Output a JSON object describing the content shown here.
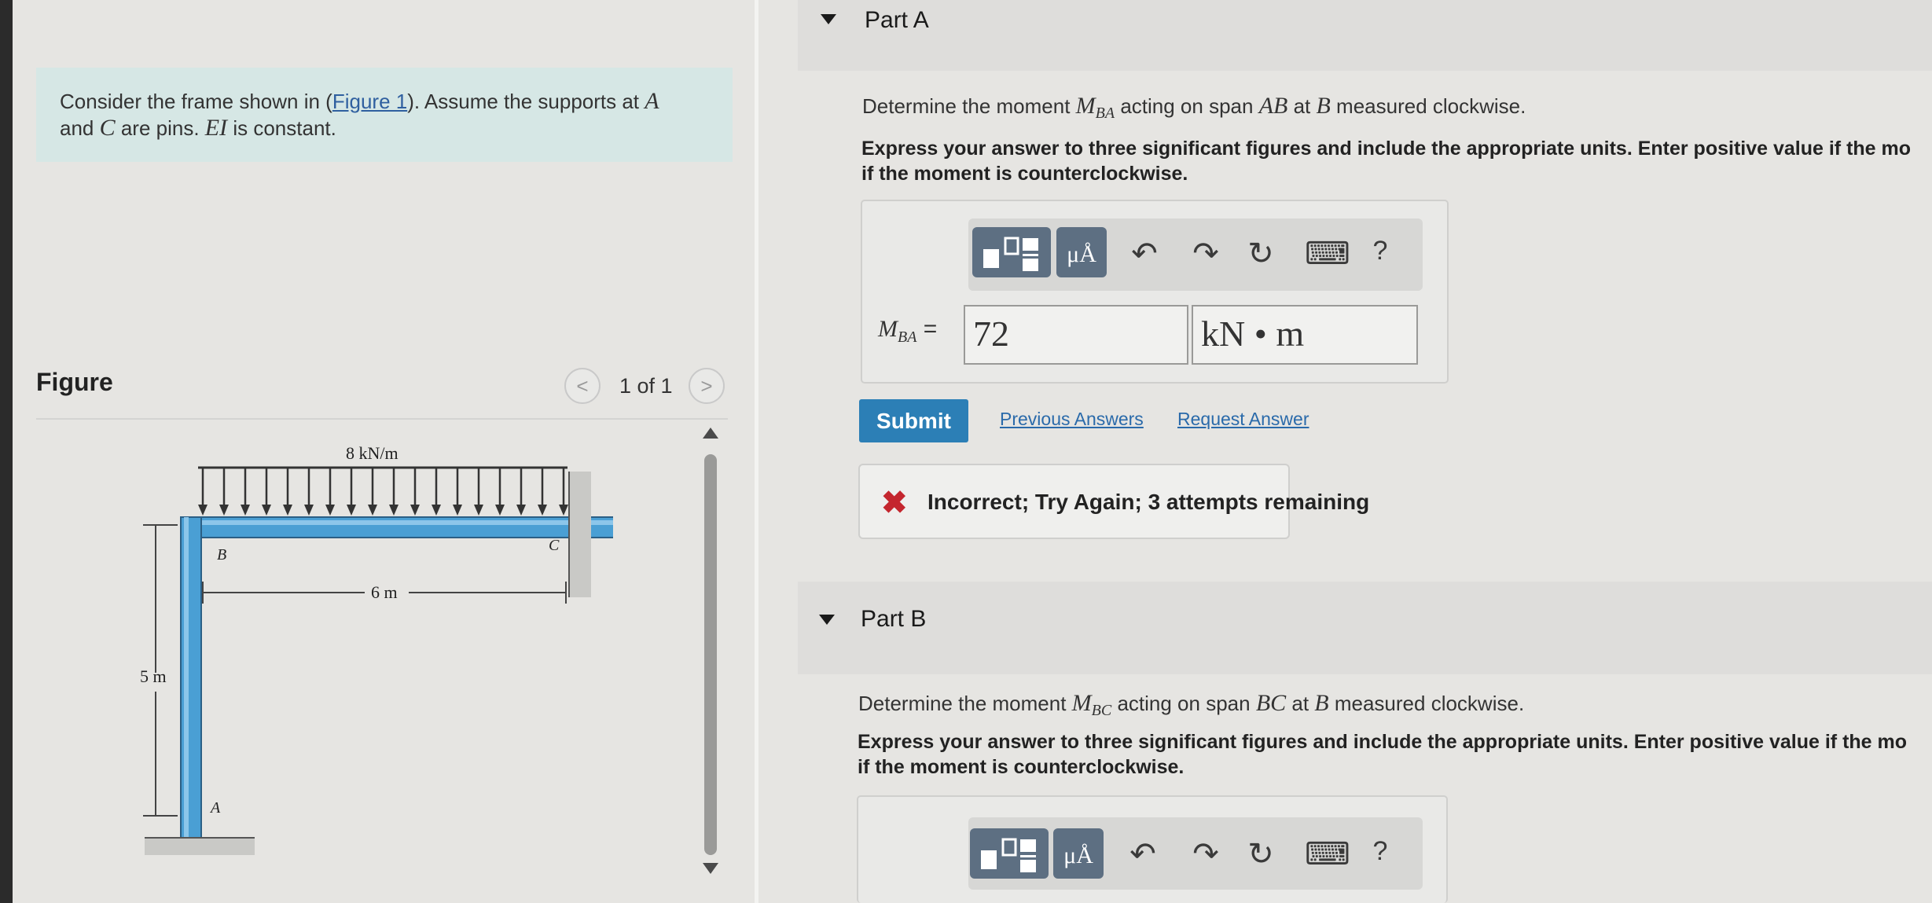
{
  "problem": {
    "intro": "Consider the frame shown in (",
    "figure_link": "Figure 1",
    "after_link": "). Assume the supports at ",
    "A": "A",
    "line2_and": "and ",
    "C": "C",
    "are_pins": " are pins. ",
    "EI": "EI",
    "is_constant": " is constant."
  },
  "figure": {
    "label": "Figure",
    "pager_text": "1 of 1",
    "prev_icon": "<",
    "next_icon": ">",
    "load_label": "8 kN/m",
    "span_label": "6 m",
    "height_label": "5 m",
    "point_A": "A",
    "point_B": "B",
    "point_C": "C"
  },
  "partA": {
    "title": "Part A",
    "question_pre": "Determine the moment ",
    "moment_M": "M",
    "moment_sub": "BA",
    "question_mid": " acting on span ",
    "span": "AB",
    "at": " at ",
    "point": "B",
    "question_post": " measured clockwise.",
    "instructions_line1": "Express your answer to three significant figures and include the appropriate units. Enter positive value if the mo",
    "instructions_line2": "if the moment is counterclockwise.",
    "eq_label_sub": "BA",
    "equals": " =",
    "value": "72",
    "units": "kN • m",
    "submit": "Submit",
    "previous_answers": "Previous Answers",
    "request_answer": "Request Answer",
    "feedback_icon": "✖",
    "feedback": "Incorrect; Try Again; 3 attempts remaining"
  },
  "partB": {
    "title": "Part B",
    "question_pre": "Determine the moment ",
    "moment_M": "M",
    "moment_sub": "BC",
    "question_mid": " acting on span ",
    "span": "BC",
    "at": " at ",
    "point": "B",
    "question_post": " measured clockwise.",
    "instructions_line1": "Express your answer to three significant figures and include the appropriate units. Enter positive value if the mo",
    "instructions_line2": "if the moment is counterclockwise."
  },
  "toolbar": {
    "templates_icon": "templates-icon",
    "symbols_label": "μÅ",
    "undo_icon": "↶",
    "redo_icon": "↷",
    "reset_icon": "↻",
    "keyboard_icon": "⌨",
    "help_label": "?"
  },
  "colors": {
    "tool_button": "#5d6f82",
    "submit": "#2c7fb6",
    "incorrect": "#c4262e",
    "beam": "#4a9fd4"
  }
}
